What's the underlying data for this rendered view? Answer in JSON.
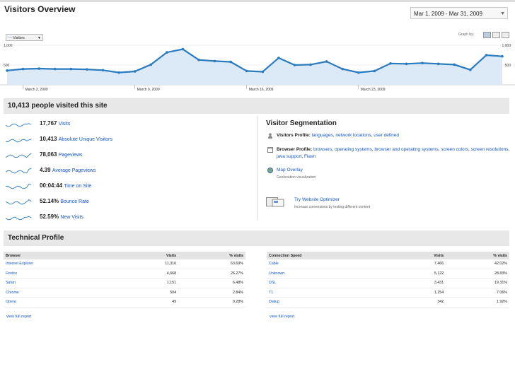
{
  "page": {
    "title": "Visitors Overview",
    "date_range": "Mar 1, 2009 - Mar 31, 2009"
  },
  "chart_controls": {
    "metric": "Visitors",
    "graph_by": "Graph by:"
  },
  "chart_data": {
    "type": "area",
    "y_ticks": [
      "1,000",
      "500"
    ],
    "ylim": [
      0,
      1000
    ],
    "x_labels": [
      "March 2, 2009",
      "March 9, 2009",
      "March 16, 2009",
      "March 23, 2009"
    ],
    "series": [
      {
        "values": [
          360,
          400,
          410,
          400,
          400,
          390,
          370,
          310,
          340,
          510,
          820,
          900,
          630,
          600,
          580,
          350,
          330,
          680,
          500,
          510,
          590,
          400,
          310,
          350,
          540,
          530,
          550,
          530,
          510,
          380,
          750,
          720
        ]
      }
    ],
    "accent": "#2b7bc0",
    "fill": "#dbeaf6"
  },
  "summary": {
    "headline": "10,413 people visited this site",
    "stats": [
      {
        "value": "17,767",
        "label": "Visits"
      },
      {
        "value": "10,413",
        "label": "Absolute Unique Visitors"
      },
      {
        "value": "78,063",
        "label": "Pageviews"
      },
      {
        "value": "4.39",
        "label": "Average Pageviews"
      },
      {
        "value": "00:04:44",
        "label": "Time on Site"
      },
      {
        "value": "52.14%",
        "label": "Bounce Rate"
      },
      {
        "value": "52.59%",
        "label": "New Visits"
      }
    ]
  },
  "segmentation": {
    "title": "Visitor Segmentation",
    "visitors_profile": {
      "label": "Visitors Profile:",
      "links": [
        "languages",
        "network locations",
        "user defined"
      ]
    },
    "browser_profile": {
      "label": "Browser Profile:",
      "links": [
        "browsers",
        "operating systems",
        "browser and operating systems",
        "screen colors",
        "screen resolutions",
        "java support",
        "Flash"
      ]
    },
    "map_overlay": {
      "label": "Map Overlay",
      "sub": "Geolocation visualization"
    },
    "optimizer": {
      "label": "Try Website Optimizer",
      "sub": "Increase conversions by testing different content"
    }
  },
  "technical": {
    "title": "Technical Profile",
    "browser": {
      "headers": [
        "Browser",
        "Visits",
        "% visits"
      ],
      "rows": [
        [
          "Internet Explorer",
          "11,316",
          "63.69%"
        ],
        [
          "Firefox",
          "4,668",
          "26.27%"
        ],
        [
          "Safari",
          "1,151",
          "6.48%"
        ],
        [
          "Chrome",
          "504",
          "2.84%"
        ],
        [
          "Opera",
          "49",
          "0.28%"
        ]
      ],
      "full_report": "view full report"
    },
    "connection": {
      "headers": [
        "Connection Speed",
        "Visits",
        "% visits"
      ],
      "rows": [
        [
          "Cable",
          "7,466",
          "42.02%"
        ],
        [
          "Unknown",
          "5,122",
          "28.83%"
        ],
        [
          "DSL",
          "3,431",
          "19.31%"
        ],
        [
          "T1",
          "1,254",
          "7.06%"
        ],
        [
          "Dialup",
          "342",
          "1.92%"
        ]
      ],
      "full_report": "view full report"
    }
  }
}
